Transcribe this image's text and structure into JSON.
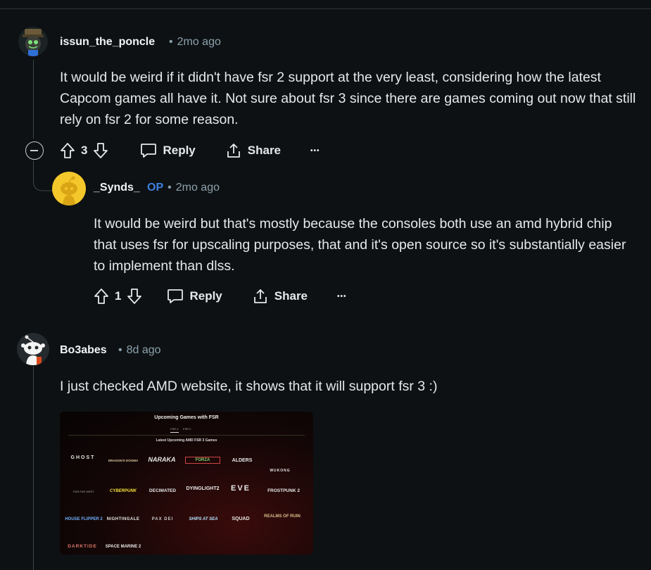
{
  "comments": [
    {
      "username": "issun_the_poncle",
      "time": "2mo ago",
      "body": "It would be weird if it didn't have fsr 2 support at the very least, considering how the latest Capcom games all have it. Not sure about fsr 3 since there are games coming out now that still rely on fsr 2 for some reason.",
      "votes": "3",
      "reply_label": "Reply",
      "share_label": "Share",
      "more_label": "•••"
    },
    {
      "username": "_Synds_",
      "op_badge": "OP",
      "time": "2mo ago",
      "body": "It would be weird but that's mostly because the consoles both use an amd hybrid chip that uses fsr for upscaling purposes, that and it's open source so it's substantially easier to implement than dlss.",
      "votes": "1",
      "reply_label": "Reply",
      "share_label": "Share",
      "more_label": "•••"
    },
    {
      "username": "Bo3abes",
      "time": "8d ago",
      "body": "I just checked AMD website, it shows that it will support fsr 3 :)"
    }
  ],
  "media": {
    "title": "Upcoming Games with FSR",
    "tabs": "FSR 3      FSR 2",
    "subtitle": "Latest Upcoming AMD FSR 3 Games",
    "games": [
      [
        "GHOST",
        "DRAGON'S DOGMA",
        "NARAKA",
        "FORZA",
        "ALDERS",
        "WUKONG"
      ],
      [
        "FAR FAR WEST",
        "CYBERPUNK",
        "DECIMATED",
        "DYINGLIGHT2",
        "EVE",
        "FROSTPUNK 2"
      ],
      [
        "HOUSE FLIPPER 2",
        "NIGHTINGALE",
        "PAX DEI",
        "SHIPS AT SEA",
        "SQUAD",
        "REALMS OF RUIN"
      ],
      [
        "DARKTIDE",
        "SPACE MARINE 2"
      ]
    ]
  },
  "colors": {
    "background": "#0e1113",
    "op": "#3d7fe0",
    "meta": "#8ba2ad",
    "synds_avatar": "#f4c82b"
  }
}
